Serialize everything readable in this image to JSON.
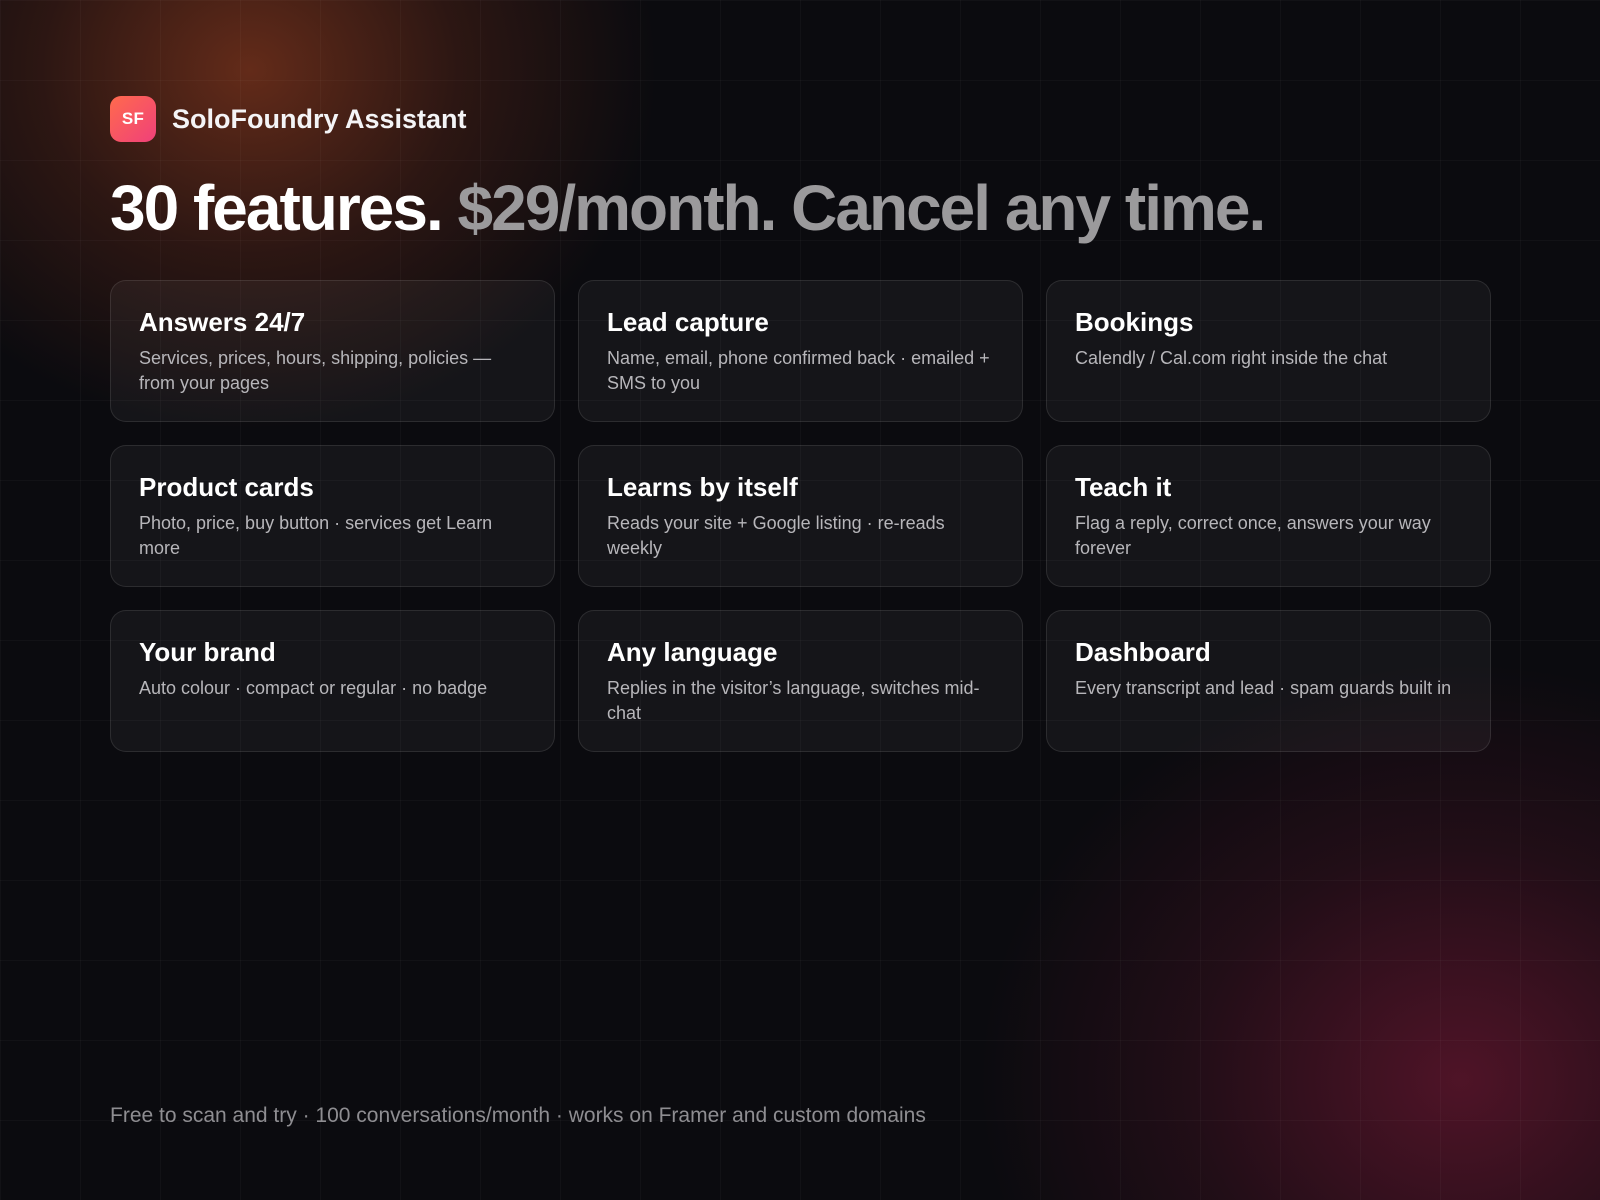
{
  "brand": {
    "logo_text": "SF",
    "name": "SoloFoundry Assistant"
  },
  "headline": {
    "strong": "30 features.",
    "muted": "$29/month. Cancel any time."
  },
  "features": [
    {
      "title": "Answers 24/7",
      "desc": "Services, prices, hours, shipping, policies — from your pages"
    },
    {
      "title": "Lead capture",
      "desc": "Name, email, phone confirmed back · emailed + SMS to you"
    },
    {
      "title": "Bookings",
      "desc": "Calendly / Cal.com right inside the chat"
    },
    {
      "title": "Product cards",
      "desc": "Photo, price, buy button · services get Learn more"
    },
    {
      "title": "Learns by itself",
      "desc": "Reads your site + Google listing · re-reads weekly"
    },
    {
      "title": "Teach it",
      "desc": "Flag a reply, correct once, answers your way forever"
    },
    {
      "title": "Your brand",
      "desc": "Auto colour · compact or regular · no badge"
    },
    {
      "title": "Any language",
      "desc": "Replies in the visitor’s language, switches mid-chat"
    },
    {
      "title": "Dashboard",
      "desc": "Every transcript and lead · spam guards built in"
    }
  ],
  "footer": "Free to scan and try · 100 conversations/month · works on Framer and custom domains",
  "colors": {
    "background": "#0b0b0f",
    "logo_gradient_start": "#ff6a4d",
    "logo_gradient_end": "#f0407a",
    "headline_muted": "#9b9a9c",
    "glow_top_left": "#7c341c",
    "glow_bottom_right": "#62162e"
  }
}
